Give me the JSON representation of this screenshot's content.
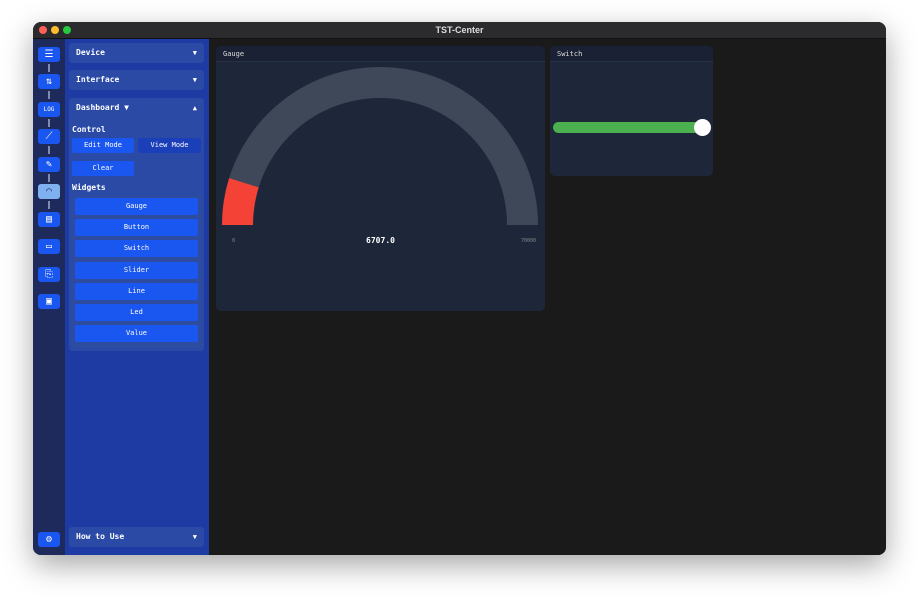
{
  "window": {
    "title": "TST-Center"
  },
  "rail": {
    "icons": [
      "menu-icon",
      "transfer-icon",
      "log-icon",
      "chart-line-icon",
      "script-icon",
      "dashboard-gauge-icon",
      "table-icon",
      "monitor-icon",
      "file-export-icon",
      "folder-search-icon",
      "settings-icon"
    ],
    "active": "dashboard-gauge-icon"
  },
  "sidebar": {
    "device": "Device",
    "interface": "Interface",
    "dashboard": "Dashboard ▼",
    "control_label": "Control",
    "edit_mode": "Edit Mode",
    "view_mode": "View Mode",
    "clear": "Clear",
    "widgets_label": "Widgets",
    "widgets": [
      "Gauge",
      "Button",
      "Switch",
      "Slider",
      "Line",
      "Led",
      "Value"
    ],
    "how_to_use": "How to Use"
  },
  "gauge": {
    "title": "Gauge",
    "value": 6707,
    "value_text": "6707.0",
    "min": 0,
    "max": 70000,
    "min_text": "0",
    "max_text": "70000",
    "fill_color": "#f44336",
    "track_color": "#3e4858"
  },
  "switch": {
    "title": "Switch",
    "on": true,
    "on_color": "#4caf50"
  }
}
